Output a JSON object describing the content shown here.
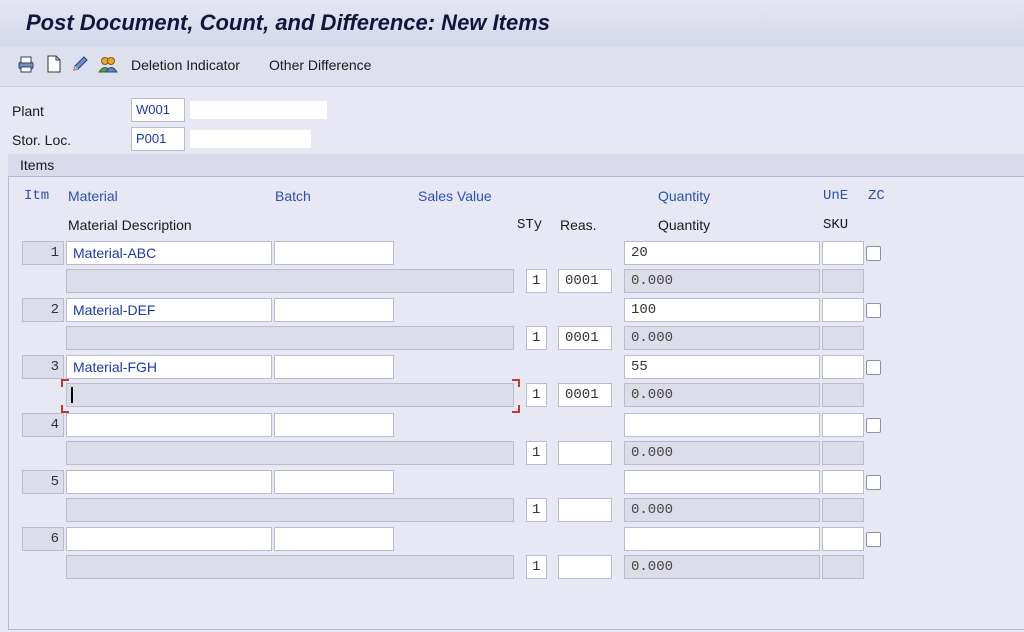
{
  "title": "Post Document, Count, and Difference: New Items",
  "toolbar": {
    "deletion_indicator": "Deletion Indicator",
    "other_difference": "Other Difference"
  },
  "header": {
    "plant_label": "Plant",
    "plant_value": "W001",
    "storloc_label": "Stor. Loc.",
    "storloc_value": "P001"
  },
  "items": {
    "title": "Items",
    "columns": {
      "itm": "Itm",
      "material": "Material",
      "batch": "Batch",
      "sales_value": "Sales Value",
      "quantity": "Quantity",
      "une": "UnE",
      "zc": "ZC",
      "material_description": "Material Description",
      "sty": "STy",
      "reas": "Reas.",
      "quantity2": "Quantity",
      "sku": "SKU"
    },
    "rows": [
      {
        "no": "1",
        "material": "Material-ABC",
        "sty": "1",
        "reason": "0001",
        "quantity": "20",
        "quantity_sku": "0.000"
      },
      {
        "no": "2",
        "material": "Material-DEF",
        "sty": "1",
        "reason": "0001",
        "quantity": "100",
        "quantity_sku": "0.000"
      },
      {
        "no": "3",
        "material": "Material-FGH",
        "sty": "1",
        "reason": "0001",
        "quantity": "55",
        "quantity_sku": "0.000"
      },
      {
        "no": "4",
        "material": "",
        "sty": "1",
        "reason": "",
        "quantity": "",
        "quantity_sku": "0.000"
      },
      {
        "no": "5",
        "material": "",
        "sty": "1",
        "reason": "",
        "quantity": "",
        "quantity_sku": "0.000"
      },
      {
        "no": "6",
        "material": "",
        "sty": "1",
        "reason": "",
        "quantity": "",
        "quantity_sku": "0.000"
      }
    ]
  },
  "icons": [
    "print-icon",
    "new-document-icon",
    "edit-pencil-icon",
    "user-group-icon"
  ],
  "colors": {
    "accent": "#2a4fb5",
    "focus": "#c0392b"
  }
}
